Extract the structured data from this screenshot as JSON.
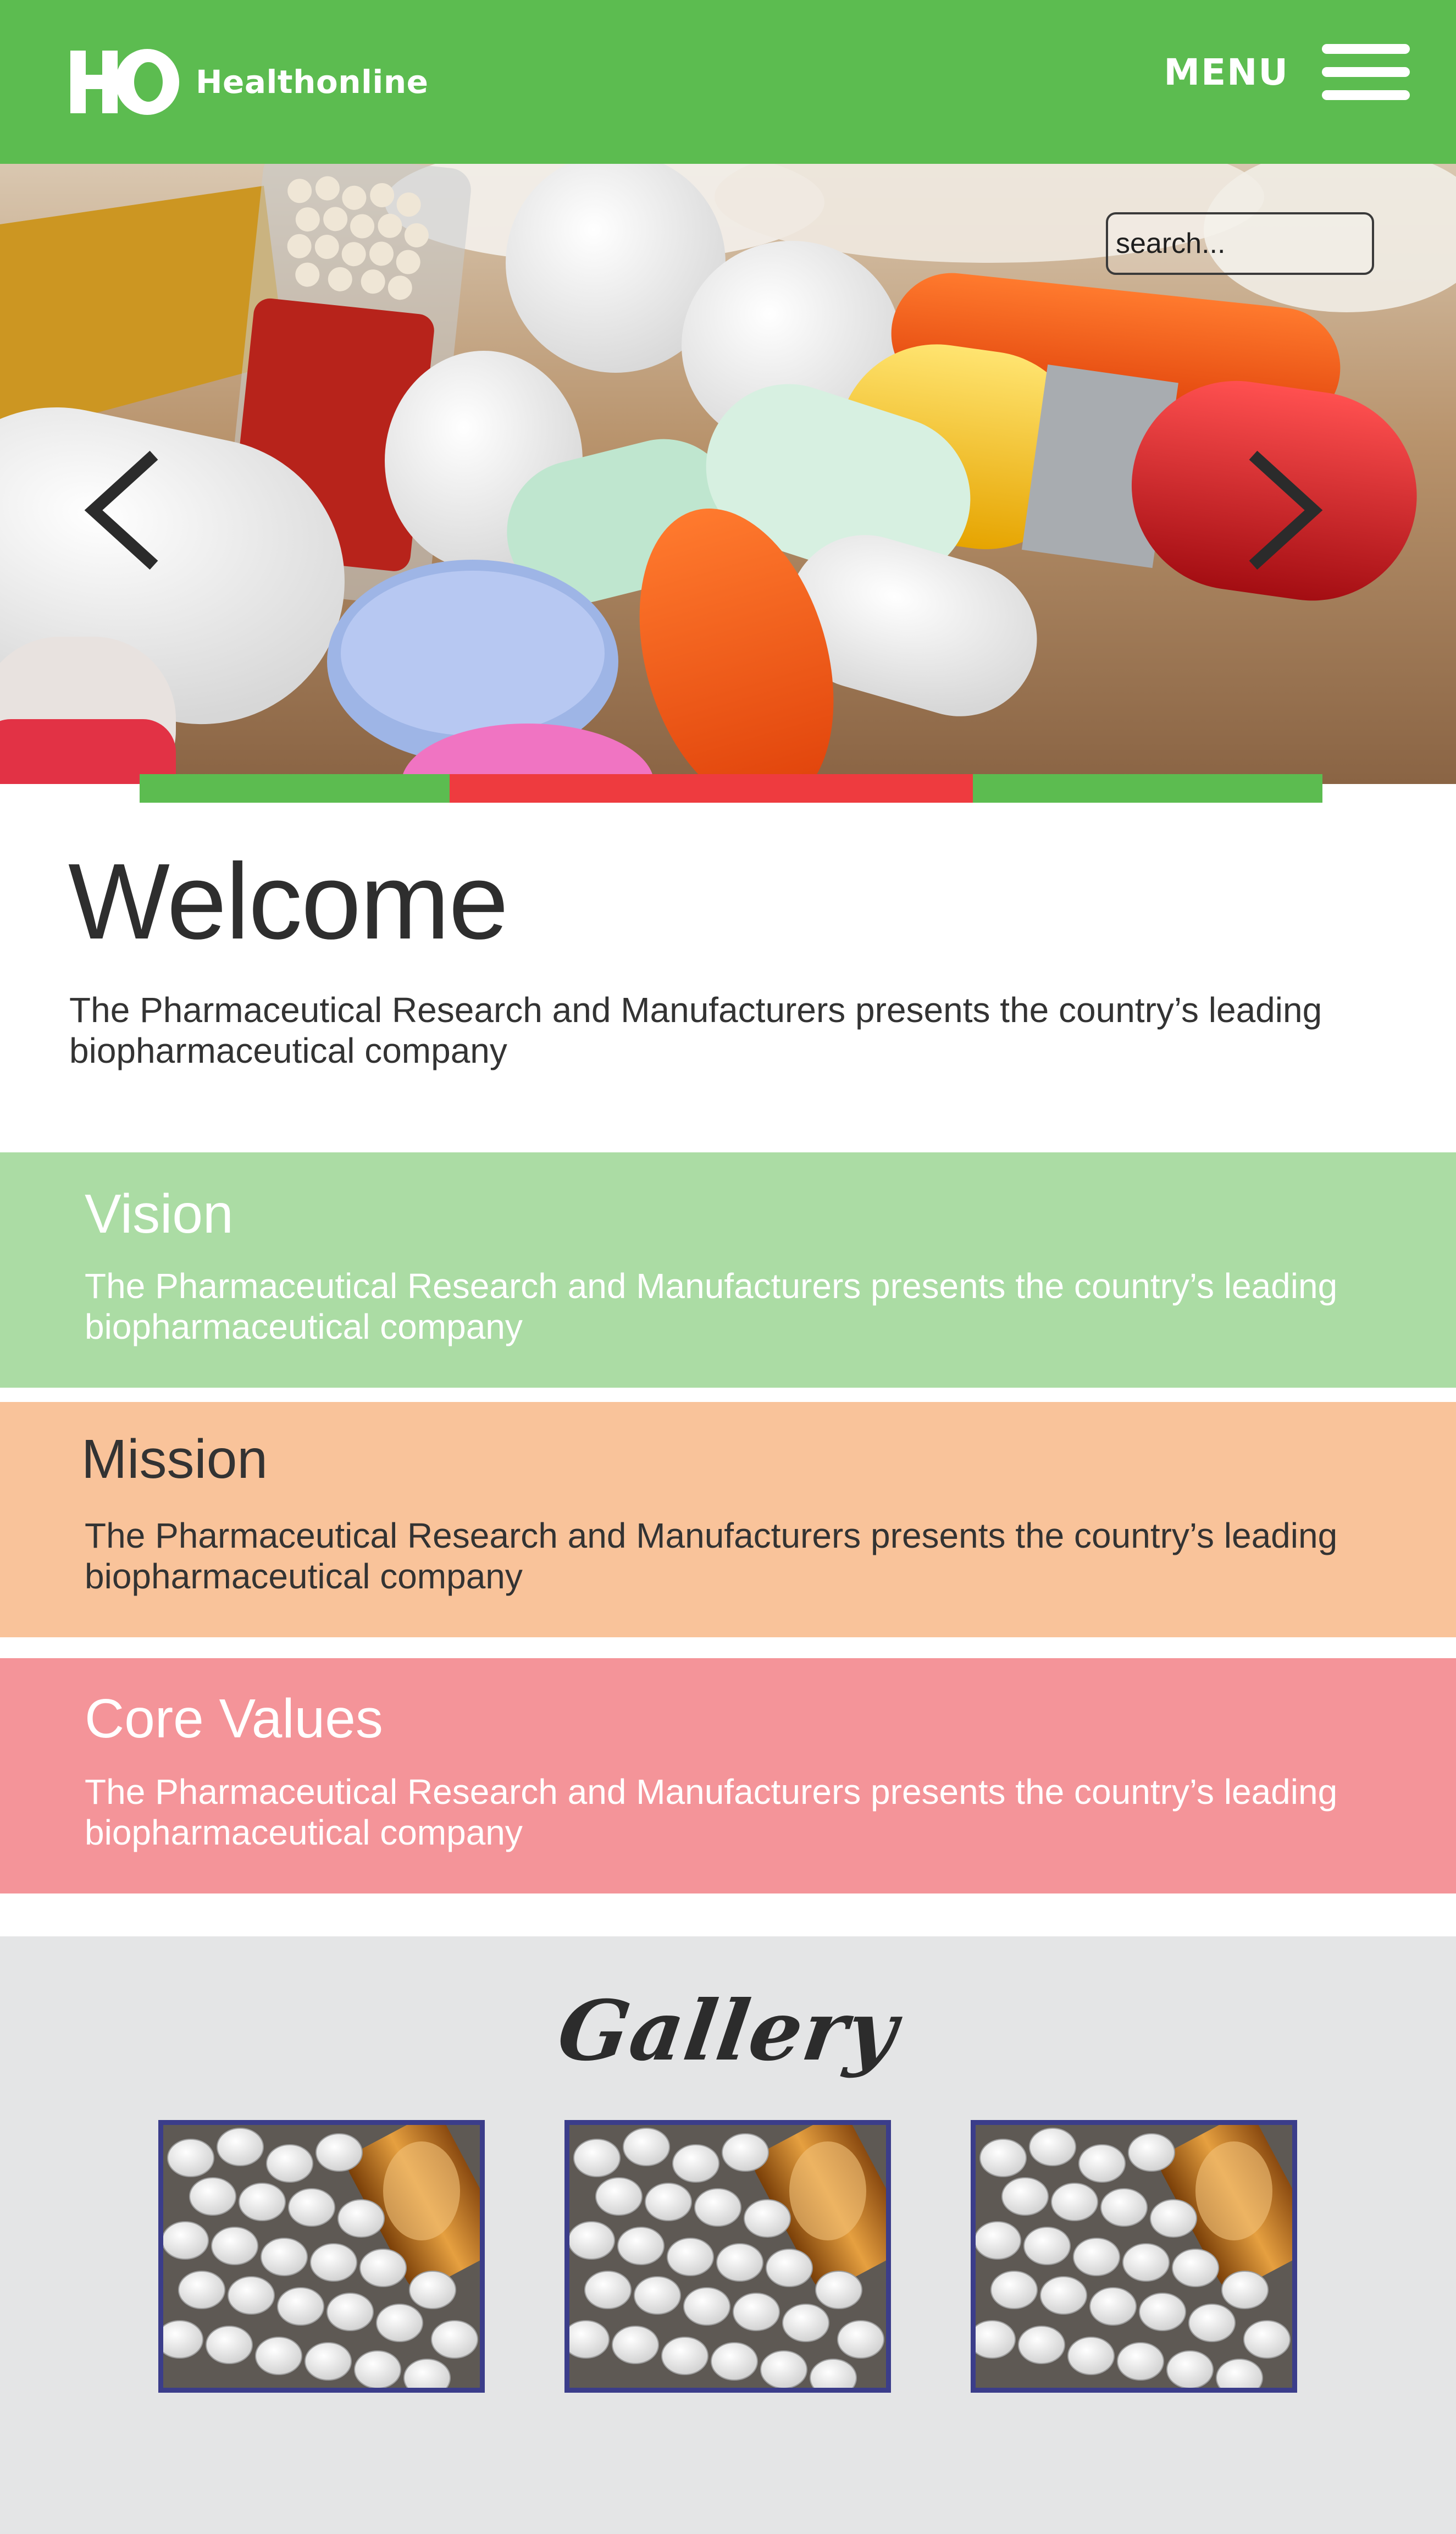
{
  "header": {
    "logo_text": "Healthonline",
    "logo_mark_text": "HO",
    "menu_label": "MENU",
    "menu_icon": "hamburger-icon",
    "background_color": "#5cbc50"
  },
  "hero": {
    "search_placeholder": "search...",
    "prev_icon": "chevron-left-icon",
    "next_icon": "chevron-right-icon",
    "image": "pills-and-capsules-photo",
    "indicators": [
      {
        "color": "#5cbc50",
        "active": false
      },
      {
        "color": "#ee3b3f",
        "active": true
      },
      {
        "color": "#5cbc50",
        "active": false
      }
    ]
  },
  "welcome": {
    "title": "Welcome",
    "text": "The Pharmaceutical Research and Manufacturers presents the country’s leading biopharmaceutical company"
  },
  "panels": {
    "vision": {
      "title": "Vision",
      "text": "The Pharmaceutical Research and Manufacturers presents the country’s leading biopharmaceutical company",
      "color": "#abdca4"
    },
    "mission": {
      "title": "Mission",
      "text": "The Pharmaceutical Research and Manufacturers presents the country’s leading biopharmaceutical company",
      "color": "#f9c39a"
    },
    "core_values": {
      "title": "Core Values",
      "text": "The Pharmaceutical Research and Manufacturers presents the country’s leading biopharmaceutical company",
      "color": "#f49499"
    }
  },
  "gallery": {
    "title": "Gallery",
    "background_color": "#e4e5e6",
    "border_color": "#3b3d8a",
    "items": [
      {
        "image": "white-pills-bottle-photo"
      },
      {
        "image": "white-pills-bottle-photo"
      },
      {
        "image": "white-pills-bottle-photo"
      }
    ]
  }
}
